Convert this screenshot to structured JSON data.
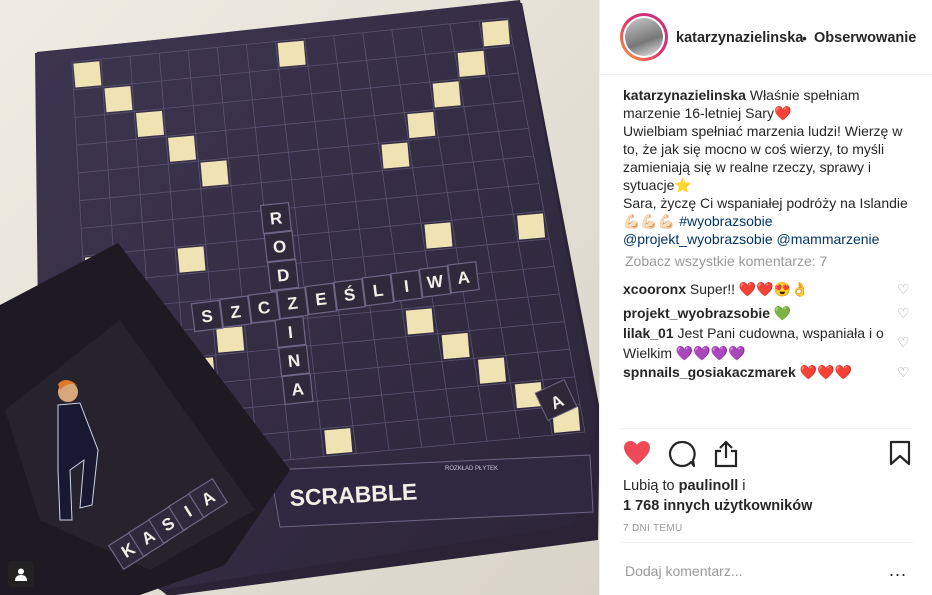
{
  "post": {
    "username": "katarzynazielinska",
    "separator": "•",
    "follow_status": "Obserwowanie"
  },
  "photo": {
    "alt": "Scrabble board with words",
    "tiles_vertical": [
      "R",
      "O",
      "D",
      "Z",
      "I",
      "N",
      "A"
    ],
    "tiles_horizontal": [
      "S",
      "Z",
      "C",
      "Z",
      "E",
      "Ś",
      "L",
      "I",
      "W",
      "A"
    ],
    "tiles_bag": [
      "K",
      "A",
      "S",
      "I",
      "A"
    ],
    "brand": "SCRABBLE",
    "user_tag_icon": "person-icon"
  },
  "caption": {
    "username": "katarzynazielinska",
    "line1": " Właśnie spełniam marzenie 16-letniej Sary❤️",
    "line2": "Uwielbiam spełniać marzenia ludzi! Wierzę w to, że jak się mocno w coś wierzy, to myśli zamieniają się w realne rzeczy, sprawy i sytuacje⭐",
    "line3": "Sara, życzę Ci wspaniałej podróży na Islandie💪🏻💪🏻💪🏻 ",
    "hashtag": "#wyobrazsobie",
    "mention1": "@projekt_wyobrazsobie",
    "mention2": "@mammarzenie"
  },
  "view_all": "Zobacz wszystkie komentarze: 7",
  "comments": [
    {
      "user": "xcooronx",
      "text": " Super!! ❤️❤️😍👌"
    },
    {
      "user": "projekt_wyobrazsobie",
      "text": " 💚"
    },
    {
      "user": "lilak_01",
      "text": " Jest Pani cudowna, wspaniała i o Wielkim 💜💜💜💜"
    },
    {
      "user": "spnnails_gosiakaczmarek",
      "text": " ❤️❤️❤️"
    }
  ],
  "actions": {
    "like_icon": "heart-filled-icon",
    "comment_icon": "comment-icon",
    "share_icon": "share-icon",
    "save_icon": "bookmark-icon",
    "like_color": "#ed4956"
  },
  "likes": {
    "prefix": "Lubią to ",
    "user": "paulinoll",
    "mid": " i",
    "count": "1 768 innych użytkowników"
  },
  "time": "7 DNI TEMU",
  "add_comment": "Dodaj komentarz...",
  "more": "..."
}
